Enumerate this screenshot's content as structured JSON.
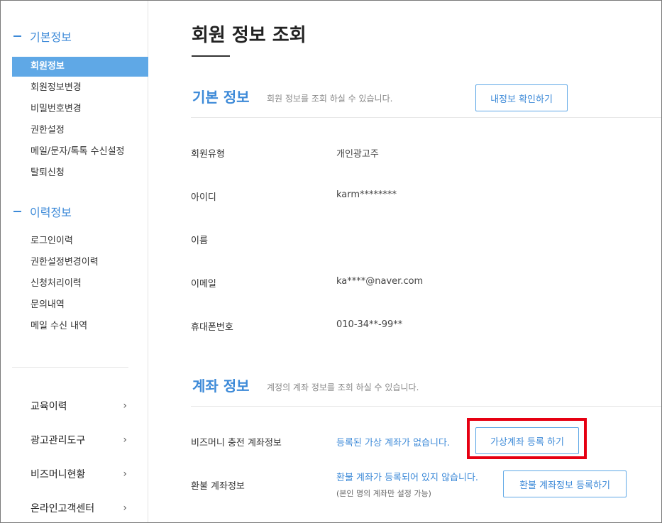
{
  "sidebar": {
    "basic_section": "기본정보",
    "basic_items": [
      {
        "label": "회원정보"
      },
      {
        "label": "회원정보변경"
      },
      {
        "label": "비밀번호변경"
      },
      {
        "label": "권한설정"
      },
      {
        "label": "메일/문자/톡톡 수신설정"
      },
      {
        "label": "탈퇴신청"
      }
    ],
    "history_section": "이력정보",
    "history_items": [
      {
        "label": "로그인이력"
      },
      {
        "label": "권한설정변경이력"
      },
      {
        "label": "신청처리이력"
      },
      {
        "label": "문의내역"
      },
      {
        "label": "메일 수신 내역"
      }
    ],
    "nav_items": [
      {
        "label": "교육이력",
        "chevron": "›"
      },
      {
        "label": "광고관리도구",
        "chevron": "›"
      },
      {
        "label": "비즈머니현황",
        "chevron": "›"
      },
      {
        "label": "온라인고객센터",
        "chevron": "›"
      }
    ]
  },
  "main": {
    "page_title": "회원 정보 조회",
    "basic": {
      "title": "기본 정보",
      "subtitle": "회원 정보를 조회 하실 수 있습니다.",
      "button": "내정보 확인하기",
      "rows": [
        {
          "label": "회원유형",
          "value": "개인광고주"
        },
        {
          "label": "아이디",
          "value": "karm********"
        },
        {
          "label": "이름",
          "value": ""
        },
        {
          "label": "이메일",
          "value": "ka****@naver.com"
        },
        {
          "label": "휴대폰번호",
          "value": "010-34**-99**"
        }
      ]
    },
    "account": {
      "title": "계좌 정보",
      "subtitle": "계정의 계좌 정보를 조회 하실 수 있습니다.",
      "bizmoney_label": "비즈머니 충전 계좌정보",
      "bizmoney_status": "등록된 가상 계좌가 없습니다.",
      "bizmoney_button": "가상계좌 등록 하기",
      "refund_label": "환불 계좌정보",
      "refund_status": "환불 계좌가 등록되어 있지 않습니다.",
      "refund_note": "(본인 명의 계좌만 설정 가능)",
      "refund_button": "환불 계좌정보 등록하기"
    }
  },
  "colors": {
    "accent": "#3d8ad8",
    "active_bg": "#5fa8e6",
    "highlight_border": "#e60012"
  }
}
